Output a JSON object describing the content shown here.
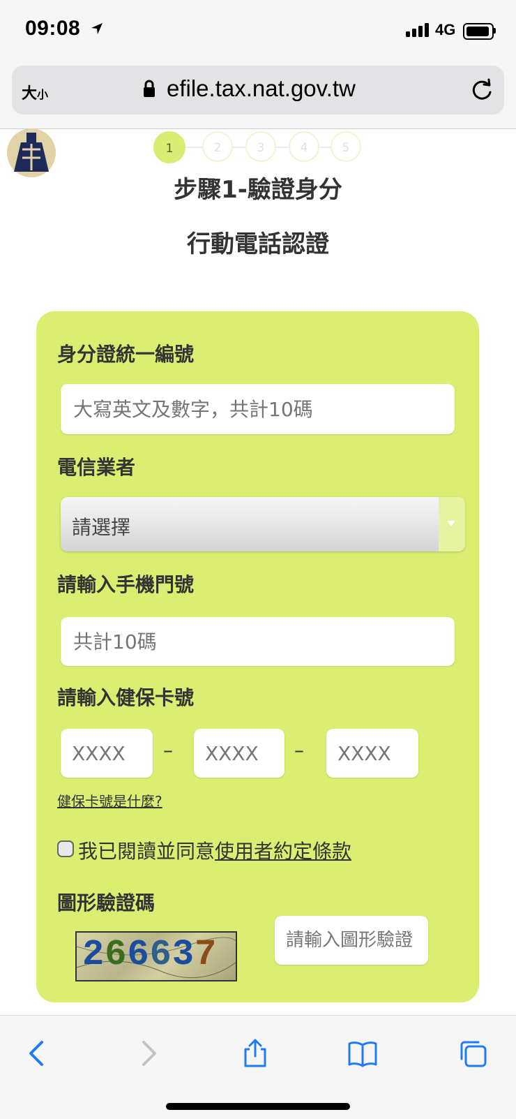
{
  "status_bar": {
    "time": "09:08",
    "network": "4G"
  },
  "browser": {
    "text_size_big": "大",
    "text_size_small": "小",
    "url": "efile.tax.nat.gov.tw"
  },
  "steps": [
    "1",
    "2",
    "3",
    "4",
    "5"
  ],
  "page": {
    "step_title": "步驟1-驗證身分",
    "subtitle": "行動電話認證"
  },
  "form": {
    "id_label": "身分證統一編號",
    "id_placeholder": "大寫英文及數字，共計10碼",
    "carrier_label": "電信業者",
    "carrier_selected": "請選擇",
    "phone_label": "請輸入手機門號",
    "phone_placeholder": "共計10碼",
    "nhi_label": "請輸入健保卡號",
    "nhi_placeholder": "XXXX",
    "dash": "–",
    "nhi_help": "健保卡號是什麼?",
    "agree_text": "我已閱讀並同意",
    "agree_link": "使用者約定條款",
    "captcha_label": "圖形驗證碼",
    "captcha_value": "266637",
    "captcha_placeholder": "請輸入圖形驗證"
  },
  "colors": {
    "card": "#dcee72",
    "accent": "#1f7cf6"
  }
}
